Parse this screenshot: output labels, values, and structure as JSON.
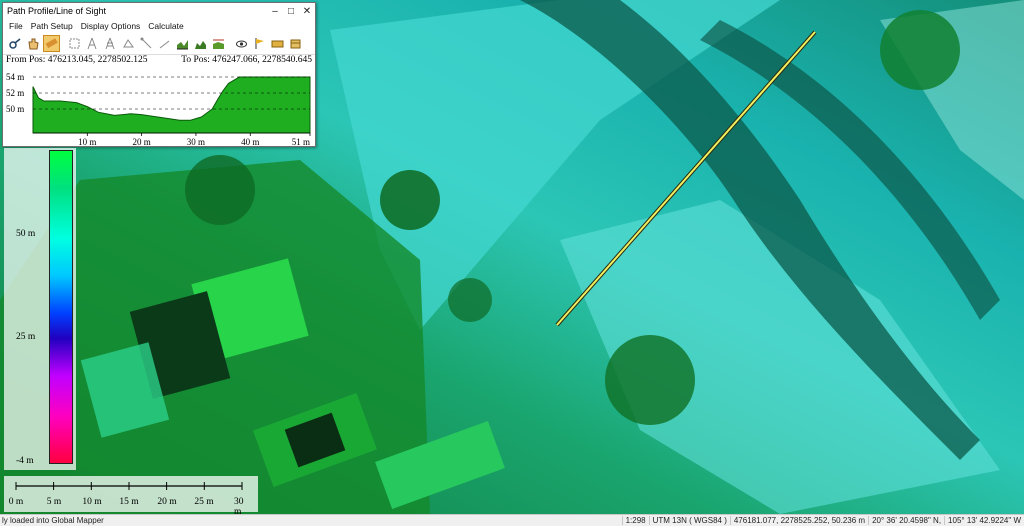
{
  "dialog": {
    "title": "Path Profile/Line of Sight",
    "window_buttons": [
      "–",
      "□",
      "✕"
    ],
    "menu": [
      "File",
      "Path Setup",
      "Display Options",
      "Calculate"
    ],
    "toolbar_icons": [
      "binoculars-icon",
      "hand-pan-icon",
      "ruler-icon",
      "select-icon",
      "tower-icon",
      "tower-2-icon",
      "antenna-icon",
      "line-icon",
      "profile-chart-icon",
      "profile-chart-2-icon",
      "profile-chart-3-icon",
      "eye-icon",
      "flag-icon",
      "settings-icon",
      "export-icon"
    ],
    "from_pos": "From Pos: 476213.045, 2278502.125",
    "to_pos": "To Pos: 476247.066, 2278540.645"
  },
  "chart_data": {
    "type": "area",
    "title": "",
    "xlabel": "",
    "ylabel": "",
    "xlim": [
      0,
      51
    ],
    "ylim": [
      47,
      54.5
    ],
    "y_ticks": [
      {
        "v": 54,
        "label": "54 m"
      },
      {
        "v": 52,
        "label": "52 m"
      },
      {
        "v": 50,
        "label": "50 m"
      }
    ],
    "x_ticks": [
      {
        "v": 10,
        "label": "10 m"
      },
      {
        "v": 20,
        "label": "20 m"
      },
      {
        "v": 30,
        "label": "30 m"
      },
      {
        "v": 40,
        "label": "40 m"
      },
      {
        "v": 51,
        "label": "51 m"
      }
    ],
    "grid": "horizontal dashed",
    "fill_color": "#1fae1f",
    "x": [
      0,
      1,
      2,
      3,
      5,
      8,
      10,
      12,
      15,
      18,
      20,
      22,
      25,
      27,
      29,
      30,
      31,
      32,
      33,
      34,
      35,
      36,
      38,
      39,
      40,
      42,
      45,
      48,
      51
    ],
    "y": [
      52.8,
      51.4,
      51.0,
      51.0,
      51.0,
      50.8,
      50.3,
      49.6,
      49.2,
      49.4,
      49.3,
      49.1,
      48.8,
      48.6,
      48.6,
      48.8,
      49.0,
      49.5,
      50.0,
      51.2,
      52.3,
      53.2,
      54.0,
      54.0,
      54.0,
      54.0,
      54.0,
      54.0,
      54.0
    ]
  },
  "legend": {
    "labels": [
      "50 m",
      "25 m",
      "-4 m"
    ]
  },
  "scale_bar": {
    "labels": [
      "0 m",
      "5 m",
      "10 m",
      "15 m",
      "20 m",
      "25 m",
      "30 m"
    ]
  },
  "status": {
    "message": "ly loaded into Global Mapper",
    "scale": "1:298",
    "projection": "UTM 13N ( WGS84 )",
    "cursor": "476181.077, 2278525.252, 50.236 m",
    "lat": "20° 36' 20.4598\" N,",
    "lon": "105° 13' 42.9224\" W"
  }
}
